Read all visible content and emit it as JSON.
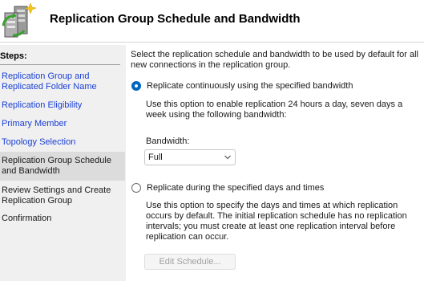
{
  "header": {
    "title": "Replication Group Schedule and Bandwidth",
    "icon": "replication-wizard-icon"
  },
  "sidebar": {
    "heading": "Steps:",
    "steps": [
      {
        "label": "Replication Group and Replicated Folder Name",
        "state": "link"
      },
      {
        "label": "Replication Eligibility",
        "state": "link"
      },
      {
        "label": "Primary Member",
        "state": "link"
      },
      {
        "label": "Topology Selection",
        "state": "link"
      },
      {
        "label": "Replication Group Schedule and Bandwidth",
        "state": "current"
      },
      {
        "label": "Review Settings and Create Replication Group",
        "state": "static"
      },
      {
        "label": "Confirmation",
        "state": "static"
      }
    ]
  },
  "main": {
    "description": "Select the replication schedule and bandwidth to be used by default for all new connections in the replication group.",
    "option_continuous": {
      "label": "Replicate continuously using the specified bandwidth",
      "selected": true,
      "help": "Use this option to enable replication 24 hours a day, seven days a week using the following bandwidth:"
    },
    "bandwidth": {
      "label": "Bandwidth:",
      "value": "Full"
    },
    "option_scheduled": {
      "label": "Replicate during the specified days and times",
      "selected": false,
      "help": "Use this option to specify the days and times at which replication occurs by default. The initial replication schedule has no replication intervals; you must create at least one replication interval before replication can occur."
    },
    "edit_schedule_label": "Edit Schedule..."
  },
  "colors": {
    "link": "#1a3fd6",
    "accent": "#0067c0",
    "sidebar_bg": "#f0f0f0",
    "current_step_bg": "#dcdcdc"
  }
}
